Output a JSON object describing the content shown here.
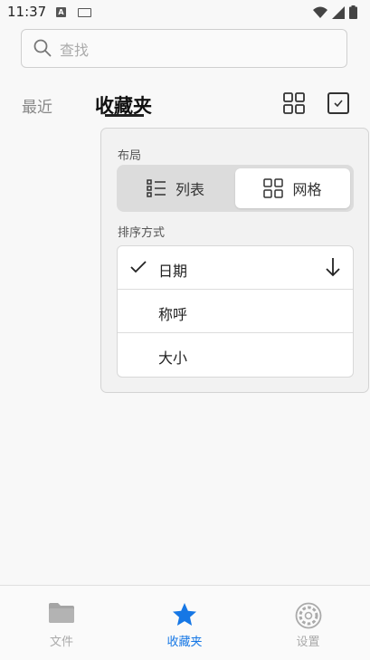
{
  "status": {
    "time": "11:37"
  },
  "search": {
    "placeholder": "查找"
  },
  "tabs": {
    "recent": "最近",
    "favorites": "收藏夹"
  },
  "popover": {
    "layout_title": "布局",
    "layout_options": [
      {
        "label": "列表",
        "selected": false
      },
      {
        "label": "网格",
        "selected": true
      }
    ],
    "sort_title": "排序方式",
    "sort_options": [
      {
        "label": "日期",
        "selected": true,
        "direction": "descending"
      },
      {
        "label": "称呼",
        "selected": false
      },
      {
        "label": "大小",
        "selected": false
      }
    ]
  },
  "bottom_nav": {
    "items": [
      {
        "label": "文件",
        "icon": "folder-icon",
        "active": false
      },
      {
        "label": "收藏夹",
        "icon": "star-icon",
        "active": true
      },
      {
        "label": "设置",
        "icon": "gear-icon",
        "active": false
      }
    ]
  },
  "colors": {
    "accent": "#1677e5",
    "inactive": "#aaaaaa"
  }
}
